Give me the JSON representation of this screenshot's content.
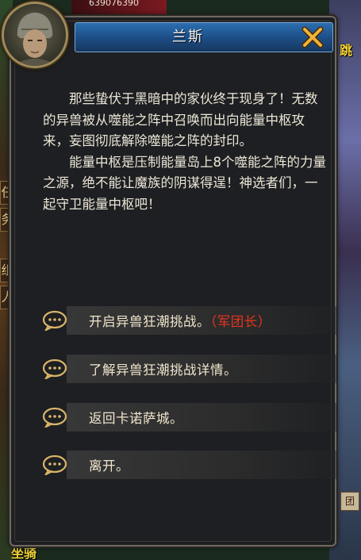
{
  "hud": {
    "hp_text": "639076390",
    "bottom_left_text": "坐骑",
    "top_right_text": "跳",
    "side_tab_1": "任",
    "side_tab_2": "务",
    "side_tab_3": "组",
    "side_tab_4": "人",
    "right_badge": "团"
  },
  "dialog": {
    "title": "兰斯",
    "paragraphs": [
      "那些蛰伏于黑暗中的家伙终于现身了！无数的异兽被从噬能之阵中召唤而出向能量中枢攻来，妄图彻底解除噬能之阵的封印。",
      "能量中枢是压制能量岛上8个噬能之阵的力量之源，绝不能让魔族的阴谋得逞！神选者们，一起守卫能量中枢吧！"
    ],
    "options": [
      {
        "label": "开启异兽狂潮挑战。",
        "tag": "（军团长）"
      },
      {
        "label": "了解异兽狂潮挑战详情。",
        "tag": ""
      },
      {
        "label": "返回卡诺萨城。",
        "tag": ""
      },
      {
        "label": "离开。",
        "tag": ""
      }
    ]
  },
  "colors": {
    "title_bar": "#1e4f88",
    "option_text": "#f1e6cc",
    "tag_text": "#e8341c",
    "icon_gold": "#d9b46a"
  }
}
